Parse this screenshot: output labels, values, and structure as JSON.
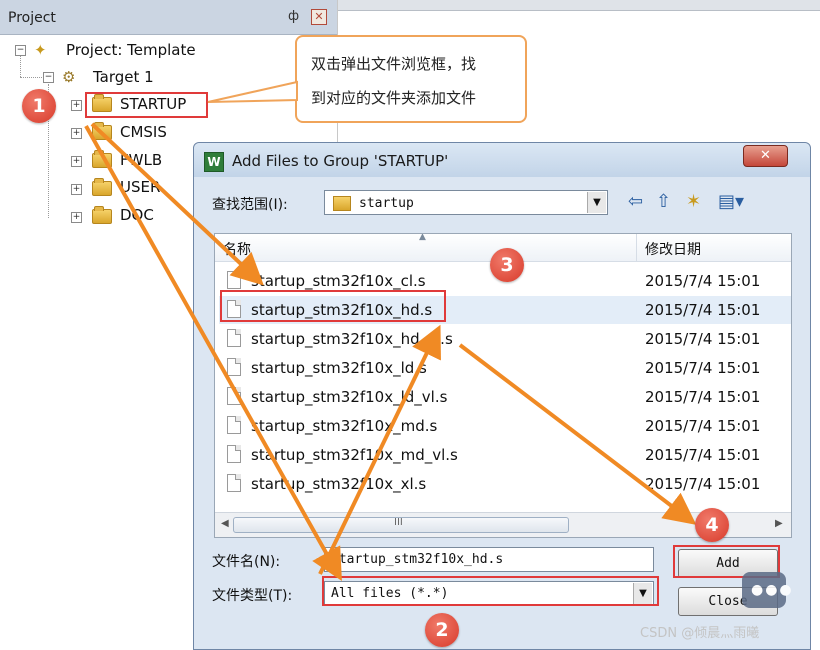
{
  "project_panel": {
    "title": "Project",
    "pin_glyph": "ф",
    "close_glyph": "✕",
    "tree": {
      "project_label": "Project: Template",
      "target_label": "Target 1",
      "groups": [
        "STARTUP",
        "CMSIS",
        "FWLB",
        "USER",
        "DOC"
      ]
    }
  },
  "callout": {
    "line1": "双击弹出文件浏览框，找",
    "line2": "到对应的文件夹添加文件"
  },
  "dialog": {
    "title": "Add Files to Group 'STARTUP'",
    "close_glyph": "✕",
    "look_in_label": "查找范围(I):",
    "look_in_value": "startup",
    "columns": {
      "name": "名称",
      "date": "修改日期"
    },
    "files": [
      {
        "name": "startup_stm32f10x_cl.s",
        "date": "2015/7/4 15:01"
      },
      {
        "name": "startup_stm32f10x_hd.s",
        "date": "2015/7/4 15:01"
      },
      {
        "name": "startup_stm32f10x_hd_vl.s",
        "date": "2015/7/4 15:01"
      },
      {
        "name": "startup_stm32f10x_ld.s",
        "date": "2015/7/4 15:01"
      },
      {
        "name": "startup_stm32f10x_ld_vl.s",
        "date": "2015/7/4 15:01"
      },
      {
        "name": "startup_stm32f10x_md.s",
        "date": "2015/7/4 15:01"
      },
      {
        "name": "startup_stm32f10x_md_vl.s",
        "date": "2015/7/4 15:01"
      },
      {
        "name": "startup_stm32f10x_xl.s",
        "date": "2015/7/4 15:01"
      }
    ],
    "scroll_grip": "III",
    "file_name_label": "文件名(N):",
    "file_name_value": "startup_stm32f10x_hd.s",
    "file_type_label": "文件类型(T):",
    "file_type_value": "All files (*.*)",
    "add_button": "Add",
    "close_button": "Close"
  },
  "annotations": {
    "badges": [
      "1",
      "2",
      "3",
      "4"
    ],
    "box_color": "#e03a3a",
    "arrow_color": "#f08a24"
  },
  "watermark": "CSDN @倾晨灬雨曦"
}
